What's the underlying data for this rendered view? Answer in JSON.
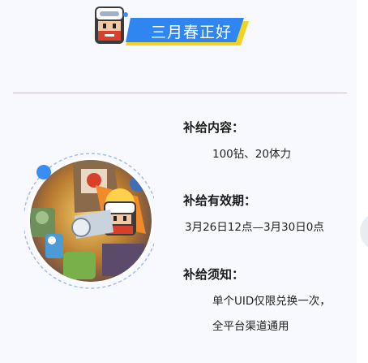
{
  "banner": {
    "title": "三月春正好"
  },
  "sections": [
    {
      "heading": "补给内容：",
      "lines": [
        "100钻、20体力"
      ]
    },
    {
      "heading": "补给有效期：",
      "lines": [
        "3月26日12点—3月30日0点"
      ]
    },
    {
      "heading": "补给须知：",
      "lines": [
        "单个UID仅限兑换一次，",
        "全平台渠道通用"
      ]
    }
  ],
  "colors": {
    "accent_blue": "#3a8df5",
    "banner_yellow": "#f5d21e",
    "divider": "#c9b7d9"
  }
}
